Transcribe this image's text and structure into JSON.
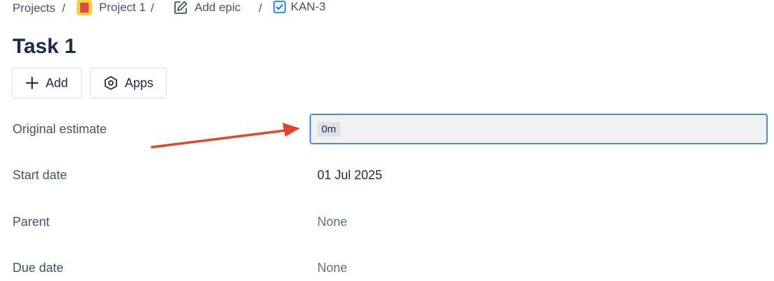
{
  "breadcrumb": {
    "projects": "Projects",
    "separator": "/",
    "project": "Project 1",
    "epic": "Add epic",
    "issue": "KAN-3"
  },
  "issue": {
    "title": "Task 1"
  },
  "toolbar": {
    "add_label": "Add",
    "apps_label": "Apps"
  },
  "fields": {
    "original_estimate": {
      "label": "Original estimate",
      "value": "0m"
    },
    "start_date": {
      "label": "Start date",
      "value": "01 Jul 2025"
    },
    "parent": {
      "label": "Parent",
      "value": "None"
    },
    "due_date": {
      "label": "Due date",
      "value": "None"
    }
  },
  "colors": {
    "accent": "#4c8bdc",
    "annotation_arrow": "#e4452a",
    "project_icon_bg": "#f5cd47",
    "project_icon_flag": "#e2483d"
  },
  "icons": {
    "project": "project-flag-icon",
    "epic": "edit-icon",
    "issue": "checkbox-icon",
    "add": "plus-icon",
    "apps": "hexagon-icon"
  }
}
